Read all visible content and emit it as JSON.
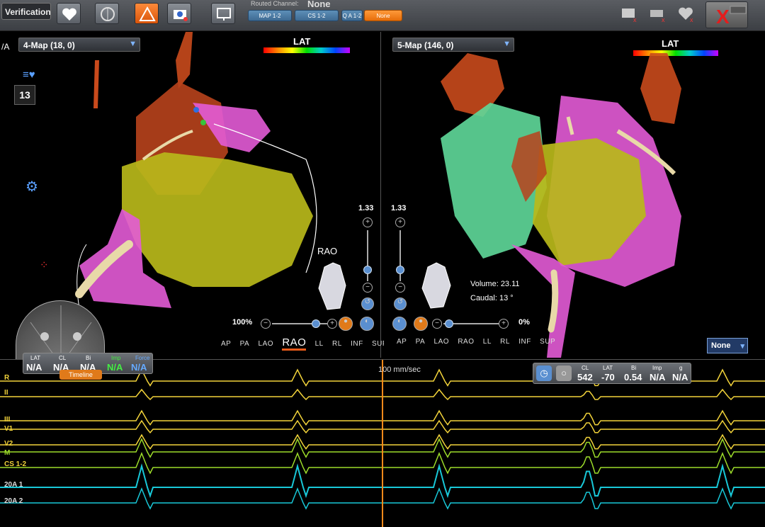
{
  "toolbar": {
    "verification_label": "Verification",
    "routed_channel_label": "Routed Channel:",
    "routed_channel_value": "None",
    "channel_chips": [
      "MAP 1-2",
      "CS 1-2",
      "Q A 1-2",
      "None"
    ]
  },
  "left_panel": {
    "title": "4-Map (18, 0)",
    "lat_label": "LAT",
    "view_label": "RAO",
    "zoom_scale": "1.33",
    "opacity": "100%",
    "views": [
      "AP",
      "PA",
      "LAO",
      "RAO",
      "LL",
      "RL",
      "INF",
      "SUP"
    ],
    "active_view": "RAO",
    "counter": "13"
  },
  "right_panel": {
    "title": "5-Map (146, 0)",
    "lat_label": "LAT",
    "zoom_scale": "1.33",
    "opacity": "0%",
    "volume_label": "Volume:",
    "volume_value": "23.11",
    "caudal_label": "Caudal:",
    "caudal_value": "13 °",
    "views": [
      "AP",
      "PA",
      "LAO",
      "RAO",
      "LL",
      "RL",
      "INF",
      "SUP"
    ],
    "none_dropdown": "None"
  },
  "ecg": {
    "speed": "100 mm/sec",
    "leads": [
      "R",
      "II",
      "III",
      "V1",
      "V2",
      "M",
      "CS 1-2",
      "20A 1",
      "20A 2"
    ],
    "left_ribbon": {
      "headers": [
        "LAT",
        "CL",
        "Bi",
        "Imp",
        "Force"
      ],
      "values": [
        "N/A",
        "N/A",
        "N/A",
        "N/A",
        "N/A"
      ],
      "timeline_label": "Timeline"
    },
    "right_ribbon": {
      "headers": [
        "CL",
        "LAT",
        "Bi",
        "Imp",
        "g"
      ],
      "values": [
        "542",
        "-70",
        "0.54",
        "N/A",
        "N/A"
      ]
    }
  },
  "colors": {
    "lead_yellow": "#f2d33a",
    "lead_green": "#9ddc2a",
    "lead_cyan": "#18c8d8",
    "cursor": "#ff8a1a"
  }
}
